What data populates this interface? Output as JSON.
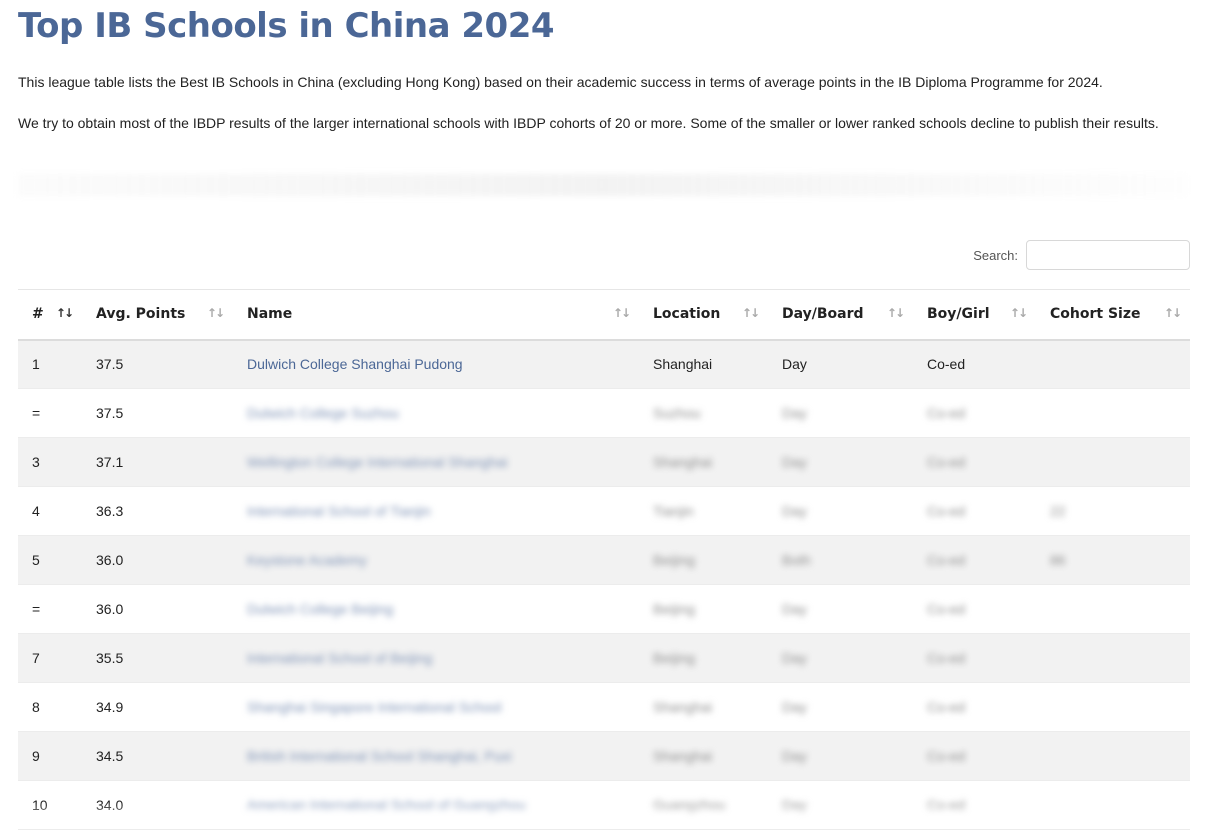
{
  "page": {
    "title": "Top IB Schools in China 2024",
    "intro_1": "This league table lists the Best IB Schools in China (excluding Hong Kong) based on their academic success in terms of average points in the IB Diploma Programme for 2024.",
    "intro_2": "We try to obtain most of the IBDP results of the larger international schools with IBDP cohorts of 20 or more. Some of the smaller or lower ranked schools decline to publish their results."
  },
  "search": {
    "label": "Search:",
    "value": "",
    "placeholder": ""
  },
  "table": {
    "columns": [
      {
        "label": "#",
        "sort_icon": "sort-asc-icon"
      },
      {
        "label": "Avg. Points",
        "sort_icon": "sort-icon"
      },
      {
        "label": "Name",
        "sort_icon": "sort-icon"
      },
      {
        "label": "Location",
        "sort_icon": "sort-icon"
      },
      {
        "label": "Day/Board",
        "sort_icon": "sort-icon"
      },
      {
        "label": "Boy/Girl",
        "sort_icon": "sort-icon"
      },
      {
        "label": "Cohort Size",
        "sort_icon": "sort-icon"
      }
    ],
    "rows": [
      {
        "rank": "1",
        "points": "37.5",
        "name": "Dulwich College Shanghai Pudong",
        "location": "Shanghai",
        "day_board": "Day",
        "gender": "Co-ed",
        "cohort": "",
        "blurred": false
      },
      {
        "rank": "=",
        "points": "37.5",
        "name": "Dulwich College Suzhou",
        "location": "Suzhou",
        "day_board": "Day",
        "gender": "Co-ed",
        "cohort": "",
        "blurred": true
      },
      {
        "rank": "3",
        "points": "37.1",
        "name": "Wellington College International Shanghai",
        "location": "Shanghai",
        "day_board": "Day",
        "gender": "Co-ed",
        "cohort": "",
        "blurred": true
      },
      {
        "rank": "4",
        "points": "36.3",
        "name": "International School of Tianjin",
        "location": "Tianjin",
        "day_board": "Day",
        "gender": "Co-ed",
        "cohort": "22",
        "blurred": true
      },
      {
        "rank": "5",
        "points": "36.0",
        "name": "Keystone Academy",
        "location": "Beijing",
        "day_board": "Both",
        "gender": "Co-ed",
        "cohort": "86",
        "blurred": true
      },
      {
        "rank": "=",
        "points": "36.0",
        "name": "Dulwich College Beijing",
        "location": "Beijing",
        "day_board": "Day",
        "gender": "Co-ed",
        "cohort": "",
        "blurred": true
      },
      {
        "rank": "7",
        "points": "35.5",
        "name": "International School of Beijing",
        "location": "Beijing",
        "day_board": "Day",
        "gender": "Co-ed",
        "cohort": "",
        "blurred": true
      },
      {
        "rank": "8",
        "points": "34.9",
        "name": "Shanghai Singapore International School",
        "location": "Shanghai",
        "day_board": "Day",
        "gender": "Co-ed",
        "cohort": "",
        "blurred": true
      },
      {
        "rank": "9",
        "points": "34.5",
        "name": "British International School Shanghai, Puxi",
        "location": "Shanghai",
        "day_board": "Day",
        "gender": "Co-ed",
        "cohort": "",
        "blurred": true
      },
      {
        "rank": "10",
        "points": "34.0",
        "name": "American International School of Guangzhou",
        "location": "Guangzhou",
        "day_board": "Day",
        "gender": "Co-ed",
        "cohort": "",
        "blurred": true
      }
    ]
  },
  "colors": {
    "title": "#4b6796",
    "link": "#4b6796",
    "stripe": "#f2f2f2"
  }
}
